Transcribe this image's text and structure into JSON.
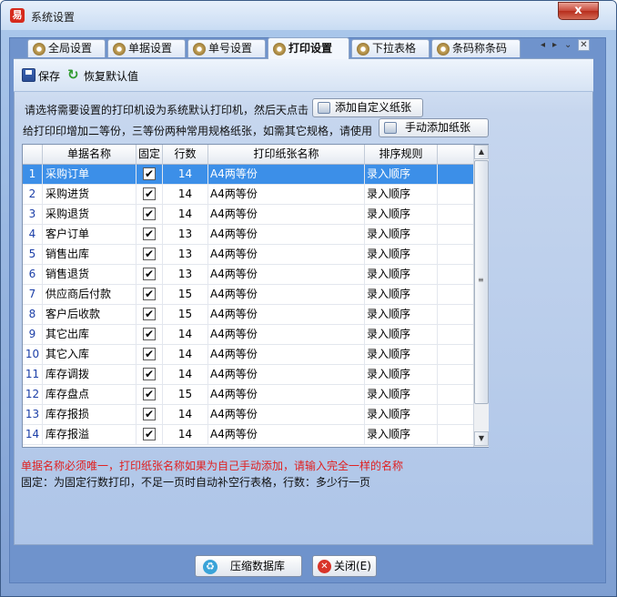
{
  "window": {
    "title": "系统设置",
    "close_glyph": "x"
  },
  "tabs": [
    {
      "label": "全局设置"
    },
    {
      "label": "单据设置"
    },
    {
      "label": "单号设置"
    },
    {
      "label": "打印设置",
      "active": true
    },
    {
      "label": "下拉表格"
    },
    {
      "label": "条码称条码"
    }
  ],
  "tab_nav": {
    "prev": "◂",
    "next": "▸",
    "menu": "⌄",
    "close": "✕"
  },
  "toolbar": {
    "save_label": "保存",
    "restore_label": "恢复默认值"
  },
  "instructions": {
    "line1": "请选将需要设置的打印机设为系统默认打印机，然后天点击",
    "add_custom_paper": "添加自定义纸张",
    "line2": "给打印印增加二等份，三等份两种常用规格纸张，如需其它规格，请使用",
    "manual_add_paper": "手动添加纸张"
  },
  "grid": {
    "columns": [
      "单据名称",
      "固定",
      "行数",
      "打印纸张名称",
      "排序规则"
    ],
    "rows": [
      {
        "no": "1",
        "name": "采购订单",
        "fixed": "✔",
        "lines": "14",
        "paper": "A4两等份",
        "sort": "录入顺序"
      },
      {
        "no": "2",
        "name": "采购进货",
        "fixed": "✔",
        "lines": "14",
        "paper": "A4两等份",
        "sort": "录入顺序"
      },
      {
        "no": "3",
        "name": "采购退货",
        "fixed": "✔",
        "lines": "14",
        "paper": "A4两等份",
        "sort": "录入顺序"
      },
      {
        "no": "4",
        "name": "客户订单",
        "fixed": "✔",
        "lines": "13",
        "paper": "A4两等份",
        "sort": "录入顺序"
      },
      {
        "no": "5",
        "name": "销售出库",
        "fixed": "✔",
        "lines": "13",
        "paper": "A4两等份",
        "sort": "录入顺序"
      },
      {
        "no": "6",
        "name": "销售退货",
        "fixed": "✔",
        "lines": "13",
        "paper": "A4两等份",
        "sort": "录入顺序"
      },
      {
        "no": "7",
        "name": "供应商后付款",
        "fixed": "✔",
        "lines": "15",
        "paper": "A4两等份",
        "sort": "录入顺序"
      },
      {
        "no": "8",
        "name": "客户后收款",
        "fixed": "✔",
        "lines": "15",
        "paper": "A4两等份",
        "sort": "录入顺序"
      },
      {
        "no": "9",
        "name": "其它出库",
        "fixed": "✔",
        "lines": "14",
        "paper": "A4两等份",
        "sort": "录入顺序"
      },
      {
        "no": "10",
        "name": "其它入库",
        "fixed": "✔",
        "lines": "14",
        "paper": "A4两等份",
        "sort": "录入顺序"
      },
      {
        "no": "11",
        "name": "库存调拨",
        "fixed": "✔",
        "lines": "14",
        "paper": "A4两等份",
        "sort": "录入顺序"
      },
      {
        "no": "12",
        "name": "库存盘点",
        "fixed": "✔",
        "lines": "15",
        "paper": "A4两等份",
        "sort": "录入顺序"
      },
      {
        "no": "13",
        "name": "库存报损",
        "fixed": "✔",
        "lines": "14",
        "paper": "A4两等份",
        "sort": "录入顺序"
      },
      {
        "no": "14",
        "name": "库存报溢",
        "fixed": "✔",
        "lines": "14",
        "paper": "A4两等份",
        "sort": "录入顺序"
      }
    ],
    "scroll": {
      "up": "▲",
      "down": "▼",
      "grip": "≡"
    }
  },
  "notes": {
    "red": "单据名称必须唯一，打印纸张名称如果为自己手动添加，请输入完全一样的名称",
    "black": "固定：为固定行数打印，不足一页时自动补空行表格，行数：多少行一页"
  },
  "footer": {
    "compress_label": "压缩数据库",
    "close_label": "关闭(E)"
  },
  "colors": {
    "accent": "#3c8fe8",
    "warning": "#e02020",
    "frame": "#6f93cc"
  }
}
